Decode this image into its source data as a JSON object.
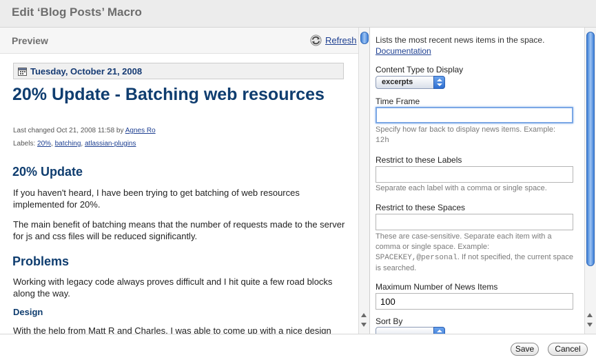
{
  "dialog": {
    "title": "Edit ‘Blog Posts’ Macro"
  },
  "preview": {
    "label": "Preview",
    "refresh_label": "Refresh",
    "date": "Tuesday, October 21, 2008",
    "post_title": "20% Update - Batching web resources",
    "meta_prefix": "Last changed Oct 21, 2008 11:58 by ",
    "meta_author": "Agnes Ro",
    "labels_prefix": "Labels: ",
    "labels": [
      "20%",
      "batching",
      "atlassian-plugins"
    ],
    "sections": {
      "h_update": "20% Update",
      "p1": "If you haven't heard, I have been trying to get batching of web resources implemented for 20%.",
      "p2": "The main benefit of batching means that the number of requests made to the server for js and css files will be reduced significantly.",
      "h_problems": "Problems",
      "p3": "Working with legacy code always proves difficult and I hit quite a few road blocks along the way.",
      "h_design": "Design",
      "p4": "With the help from Matt R and Charles, I was able to come up with a nice design"
    }
  },
  "form": {
    "description": "Lists the most recent news items in the space.",
    "doc_link": "Documentation",
    "content_type": {
      "label": "Content Type to Display",
      "value": "excerpts"
    },
    "time_frame": {
      "label": "Time Frame",
      "value": "",
      "hint": "Specify how far back to display news items. Example:",
      "hint_example": "12h"
    },
    "labels": {
      "label": "Restrict to these Labels",
      "value": "",
      "hint": "Separate each label with a comma or single space."
    },
    "spaces": {
      "label": "Restrict to these Spaces",
      "value": "",
      "hint_a": "These are case-sensitive. Separate each item with a comma or single space. Example:",
      "hint_example": "SPACEKEY,@personal",
      "hint_b": ". If not specified, the current space is searched."
    },
    "max_items": {
      "label": "Maximum Number of News Items",
      "value": "100"
    },
    "sort_by": {
      "label": "Sort By",
      "value": ""
    }
  },
  "footer": {
    "save_label": "Save",
    "cancel_label": "Cancel"
  },
  "colors": {
    "heading": "#0f3d6f",
    "link": "#1d3f91",
    "scroll_thumb": "#3f7fd8",
    "focus": "#7aa7e5"
  }
}
